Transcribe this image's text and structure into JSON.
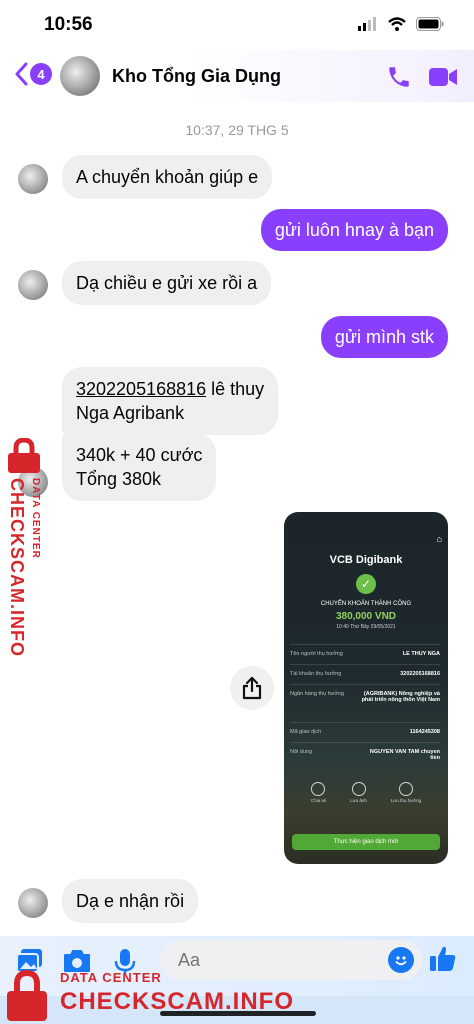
{
  "status": {
    "time": "10:56"
  },
  "header": {
    "badge": "4",
    "title": "Kho Tổng Gia Dụng"
  },
  "thread": {
    "timestamp": "10:37, 29 THG 5",
    "messages": [
      {
        "from": "them",
        "text": "A chuyển khoản giúp e"
      },
      {
        "from": "me",
        "text": "gửi luôn hnay à bạn"
      },
      {
        "from": "them",
        "text": "Dạ chiều e gửi xe rồi a"
      },
      {
        "from": "me",
        "text": "gửi mình stk"
      },
      {
        "from": "them",
        "account": "3202205168816",
        "line1_rest": " lê thuy",
        "line2": "Nga Agribank"
      },
      {
        "from": "them",
        "line1": "340k + 40 cước",
        "line2": "Tổng 380k"
      },
      {
        "from": "them",
        "text": "Dạ e nhận rồi"
      }
    ]
  },
  "receipt": {
    "logo": "VCB Digibank",
    "success": "CHUYỂN KHOẢN THÀNH CÔNG",
    "amount": "380,000 VND",
    "datetime": "10:40 Thứ Bảy 29/05/2021",
    "rows": [
      {
        "label": "Tên người thụ hưởng",
        "value": "LE THUY NGA"
      },
      {
        "label": "Tài khoản thụ hưởng",
        "value": "3202205168816"
      },
      {
        "label": "Ngân hàng thụ hưởng",
        "value": "(AGRIBANK) Nông nghiệp và phát triển nông thôn Việt Nam"
      },
      {
        "label": "Mã giao dịch",
        "value": "1164245308"
      },
      {
        "label": "Nội dung",
        "value": "NGUYEN VAN TAM chuyen tien"
      }
    ],
    "actions": [
      "Chia sẻ",
      "Lưu ảnh",
      "Lưu thụ hưởng"
    ],
    "button": "Thực hiện giao dịch mới"
  },
  "composer": {
    "placeholder": "Aa"
  },
  "watermark": {
    "line1": "DATA CENTER",
    "line2": "CHECKSCAM.INFO"
  },
  "colors": {
    "accent": "#8a3ffc",
    "bubble_in": "#efefef",
    "watermark": "#d6262c"
  }
}
